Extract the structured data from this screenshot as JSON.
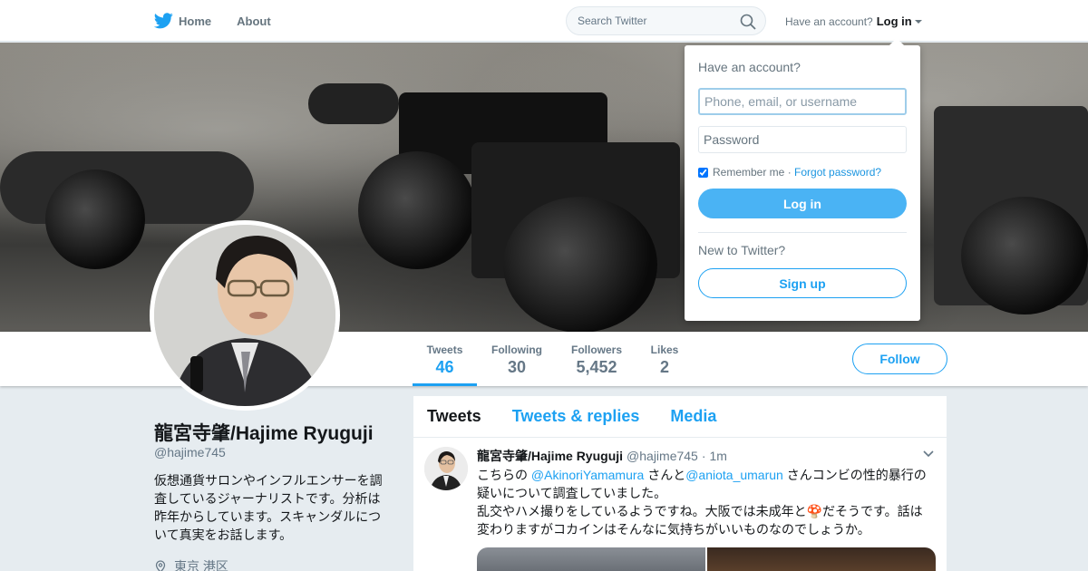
{
  "nav": {
    "home_label": "Home",
    "about_label": "About",
    "search_placeholder": "Search Twitter",
    "account_prompt": "Have an account?",
    "login_label": "Log in"
  },
  "profile": {
    "name": "龍宮寺肇/Hajime Ryuguji",
    "handle": "@hajime745",
    "bio": "仮想通貨サロンやインフルエンサーを調査しているジャーナリストです。分析は昨年からしています。スキャンダルについて真実をお話します。",
    "location": "東京 港区",
    "stats": [
      {
        "label": "Tweets",
        "value": "46"
      },
      {
        "label": "Following",
        "value": "30"
      },
      {
        "label": "Followers",
        "value": "5,452"
      },
      {
        "label": "Likes",
        "value": "2"
      }
    ],
    "follow_label": "Follow"
  },
  "timeline": {
    "tabs": [
      "Tweets",
      "Tweets & replies",
      "Media"
    ],
    "tweet": {
      "name": "龍宮寺肇/Hajime Ryuguji",
      "handle": "@hajime745",
      "dot": "·",
      "time": "1m",
      "text_1": "こちらの ",
      "mention_1": "@AkinoriYamamura",
      "text_2": " さんと",
      "mention_2": "@aniota_umarun",
      "text_3": " さんコンビの性的暴行の疑いについて調査していました。",
      "text_4": "乱交やハメ撮りをしているようですね。大阪では未成年と",
      "emoji": "🍄",
      "text_5": "だそうです。話は変わりますがコカインはそんなに気持ちがいいものなのでしょうか。"
    }
  },
  "login_dropdown": {
    "title": "Have an account?",
    "username_placeholder": "Phone, email, or username",
    "password_placeholder": "Password",
    "remember_label": "Remember me",
    "separator": " · ",
    "forgot_label": "Forgot password?",
    "login_button": "Log in",
    "new_prompt": "New to Twitter?",
    "signup_button": "Sign up"
  },
  "colors": {
    "accent": "#1da1f2",
    "login_button_bg": "#4ab3f4",
    "page_bg": "#e6ecf0"
  },
  "icons": [
    "twitter-bird-icon",
    "search-icon",
    "caret-down-icon",
    "location-pin-icon",
    "chevron-down-icon"
  ]
}
